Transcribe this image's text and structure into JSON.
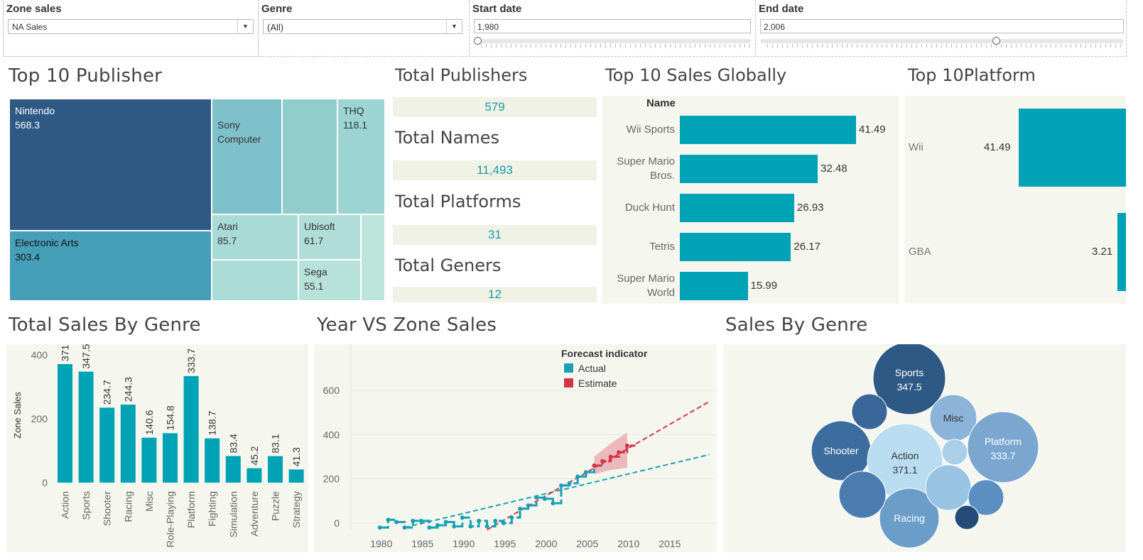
{
  "filters": {
    "zone": {
      "label": "Zone sales",
      "value": "NA Sales"
    },
    "genre": {
      "label": "Genre",
      "value": "(All)"
    },
    "start": {
      "label": "Start date",
      "value": "1,980"
    },
    "end": {
      "label": "End date",
      "value": "2,006"
    }
  },
  "publishers": {
    "title": "Top 10 Publisher",
    "items": [
      {
        "name": "Nintendo",
        "value": "568.3",
        "color": "#2e5984"
      },
      {
        "name": "Electronic Arts",
        "value": "303.4",
        "color": "#469fb9"
      },
      {
        "name": "Sony\nComputer",
        "value": "",
        "color": "#7fc1cb"
      },
      {
        "name": "THQ",
        "value": "118.1",
        "color": "#9cd3d3"
      },
      {
        "name": "Atari",
        "value": "85.7",
        "color": "#a8dad6"
      },
      {
        "name": "Ubisoft",
        "value": "61.7",
        "color": "#b1ddd8"
      },
      {
        "name": "Sega",
        "value": "55.1",
        "color": "#b7e2d9"
      }
    ]
  },
  "kpis": [
    {
      "label": "Total Publishers",
      "value": "579"
    },
    {
      "label": "Total Names",
      "value": "11,493"
    },
    {
      "label": "Total Platforms",
      "value": "31"
    },
    {
      "label": "Total Geners",
      "value": "12"
    }
  ],
  "top10": {
    "title": "Top 10 Sales Globally",
    "header": "Name",
    "items": [
      {
        "name": "Wii Sports",
        "value": 41.49,
        "label": "41.49"
      },
      {
        "name": "Super Mario\nBros.",
        "value": 32.48,
        "label": "32.48"
      },
      {
        "name": "Duck Hunt",
        "value": 26.93,
        "label": "26.93"
      },
      {
        "name": "Tetris",
        "value": 26.17,
        "label": "26.17"
      },
      {
        "name": "Super Mario\nWorld",
        "value": 15.99,
        "label": "15.99"
      }
    ]
  },
  "platforms": {
    "title": "Top 10Platform",
    "items": [
      {
        "name": "Wii",
        "value": 41.49,
        "label": "41.49"
      },
      {
        "name": "GBA",
        "value": 3.21,
        "label": "3.21"
      }
    ]
  },
  "chart_data": [
    {
      "type": "bar",
      "title": "Total Sales By Genre",
      "ylabel": "Zone Sales",
      "yticks": [
        0,
        200,
        400
      ],
      "ylim": [
        0,
        420
      ],
      "categories": [
        "Action",
        "Sports",
        "Shooter",
        "Racing",
        "Misc",
        "Role-Playing",
        "Platform",
        "Fighting",
        "Simulation",
        "Adventure",
        "Puzzle",
        "Strategy"
      ],
      "values": [
        371.1,
        347.5,
        234.7,
        244.3,
        140.6,
        154.8,
        333.7,
        138.7,
        83.4,
        45.2,
        83.1,
        41.3
      ],
      "labels": [
        "371.1",
        "347.5",
        "234.7",
        "244.3",
        "140.6",
        "154.8",
        "333.7",
        "138.7",
        "83.4",
        "45.2",
        "83.1",
        "41.3"
      ],
      "color": "#00a2b5"
    },
    {
      "type": "line",
      "title": "Year VS Zone Sales",
      "legend_title": "Forecast indicator",
      "xticks": [
        1980,
        1985,
        1990,
        1995,
        2000,
        2005,
        2010,
        2015
      ],
      "yticks": [
        0,
        200,
        400,
        600
      ],
      "xlim": [
        1977,
        2020
      ],
      "ylim": [
        -30,
        700
      ],
      "series": [
        {
          "name": "Actual",
          "color": "#1aa0b6",
          "x": [
            1980,
            1981,
            1982,
            1983,
            1984,
            1985,
            1986,
            1987,
            1988,
            1989,
            1990,
            1991,
            1992,
            1993,
            1994,
            1995,
            1996,
            1997,
            1998,
            1999,
            2000,
            2001,
            2002,
            2003,
            2004,
            2005,
            2006
          ],
          "y": [
            -20,
            15,
            5,
            -20,
            10,
            10,
            -20,
            -10,
            5,
            -15,
            25,
            -15,
            10,
            -15,
            10,
            0,
            25,
            65,
            80,
            115,
            110,
            90,
            170,
            180,
            210,
            230,
            260
          ]
        },
        {
          "name": "Estimate",
          "color": "#d3354a",
          "x": [
            2006,
            2007,
            2008,
            2009,
            2010
          ],
          "y": [
            260,
            280,
            300,
            320,
            350
          ]
        }
      ],
      "trend_actual": {
        "x": [
          1983,
          2020
        ],
        "y": [
          -20,
          310
        ]
      },
      "trend_estimate": {
        "x": [
          1993,
          2020
        ],
        "y": [
          -30,
          550
        ]
      },
      "band": {
        "x": [
          2006,
          2010
        ],
        "low": [
          220,
          230,
          240,
          245,
          250
        ],
        "high": [
          300,
          330,
          360,
          385,
          410
        ]
      }
    },
    {
      "type": "bubble",
      "title": "Sales By Genre",
      "bubbles": [
        {
          "name": "Sports",
          "value": "347.5",
          "color": "#2e5984"
        },
        {
          "name": "Shooter",
          "value": "",
          "color": "#3d6d9e"
        },
        {
          "name": "Action",
          "value": "371.1",
          "color": "#b9dcf0"
        },
        {
          "name": "Misc",
          "value": "",
          "color": "#8bb4d8"
        },
        {
          "name": "Platform",
          "value": "333.7",
          "color": "#7aa6cf"
        },
        {
          "name": "Racing",
          "value": "",
          "color": "#6b9dc9"
        },
        {
          "name": "",
          "value": "",
          "color": "#3a669a"
        },
        {
          "name": "",
          "value": "",
          "color": "#4a7cb0"
        },
        {
          "name": "",
          "value": "",
          "color": "#a9cfe9"
        },
        {
          "name": "",
          "value": "",
          "color": "#98c3e3"
        },
        {
          "name": "",
          "value": "",
          "color": "#5b8fc2"
        },
        {
          "name": "",
          "value": "",
          "color": "#234d78"
        }
      ]
    }
  ]
}
